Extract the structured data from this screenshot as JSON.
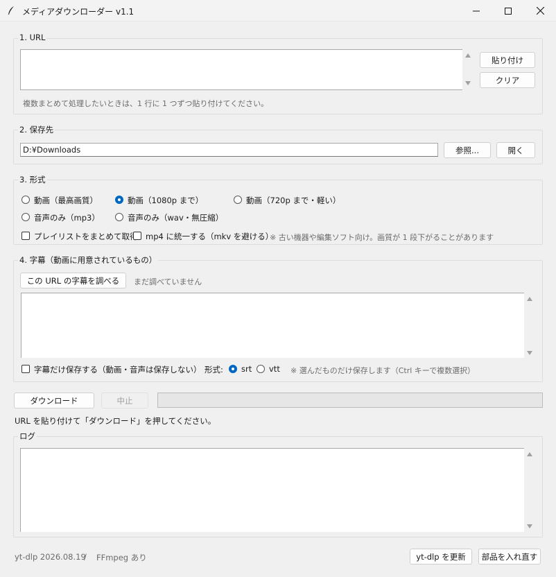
{
  "window": {
    "title": "メディアダウンローダー v1.1",
    "icon": "feather-icon"
  },
  "url_section": {
    "label": "1. URL",
    "value": "",
    "paste_label": "貼り付け",
    "clear_label": "クリア",
    "hint": "複数まとめて処理したいときは、1 行に 1 つずつ貼り付けてください。"
  },
  "save_section": {
    "label": "2. 保存先",
    "path": "D:¥Downloads",
    "browse_label": "参照...",
    "open_label": "開く"
  },
  "format_section": {
    "label": "3. 形式",
    "options": [
      "動画（最高画質）",
      "動画（1080p まで）",
      "動画（720p まで・軽い）",
      "音声のみ（mp3）",
      "音声のみ（wav・無圧縮）"
    ],
    "selected": "動画（1080p まで）",
    "playlist_label": "プレイリストをまとめて取得",
    "playlist_checked": false,
    "mp4_label": "mp4 に統一する（mkv を避ける）",
    "mp4_checked": false,
    "mp4_note": "※ 古い機器や編集ソフト向け。画質が 1 段下がることがあります"
  },
  "subtitle_section": {
    "label": "4. 字幕（動画に用意されているもの）",
    "check_button_label": "この URL の字幕を調べる",
    "status": "まだ調べていません",
    "subs_only_label": "字幕だけ保存する（動画・音声は保存しない）",
    "subs_only_checked": false,
    "format_label": "形式:",
    "format_options": [
      "srt",
      "vtt"
    ],
    "format_selected": "srt",
    "note": "※ 選んだものだけ保存します（Ctrl キーで複数選択）"
  },
  "actions": {
    "download_label": "ダウンロード",
    "stop_label": "中止",
    "progress": 0,
    "status_message": "URL を貼り付けて「ダウンロード」を押してください。"
  },
  "log_section": {
    "label": "ログ",
    "content": ""
  },
  "footer": {
    "ytdlp_version": "yt-dlp 2026.08.19",
    "separator": "/",
    "ffmpeg_status": "FFmpeg あり",
    "update_label": "yt-dlp を更新",
    "reinstall_label": "部品を入れ直す"
  },
  "colors": {
    "accent": "#0067c0",
    "background": "#f0f0f0",
    "hint_text": "#6b6b6b"
  }
}
